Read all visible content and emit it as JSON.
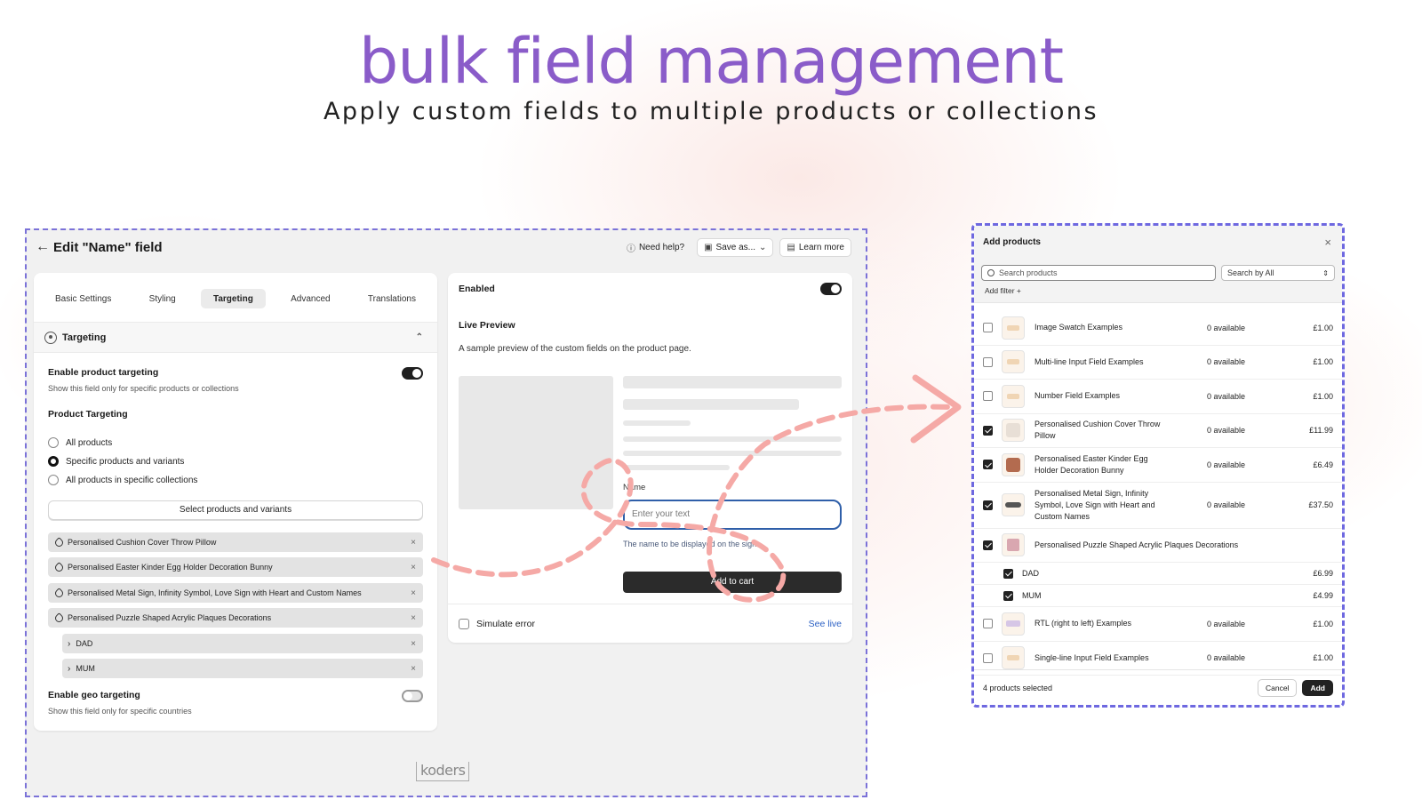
{
  "hero": {
    "title": "bulk field management",
    "subtitle": "Apply custom fields to multiple products or collections"
  },
  "editor": {
    "title": "Edit \"Name\" field",
    "actions": {
      "help": "Need help?",
      "save_as": "Save as...",
      "learn_more": "Learn more"
    },
    "tabs": [
      {
        "label": "Basic Settings",
        "active": false
      },
      {
        "label": "Styling",
        "active": false
      },
      {
        "label": "Targeting",
        "active": true
      },
      {
        "label": "Advanced",
        "active": false
      },
      {
        "label": "Translations",
        "active": false
      }
    ],
    "section_title": "Targeting",
    "product_targeting": {
      "label": "Enable product targeting",
      "help": "Show this field only for specific products or collections",
      "enabled": true
    },
    "product_targeting_heading": "Product Targeting",
    "radio_options": [
      {
        "label": "All products",
        "selected": false
      },
      {
        "label": "Specific products and variants",
        "selected": true
      },
      {
        "label": "All products in specific collections",
        "selected": false
      }
    ],
    "select_button": "Select products and variants",
    "chips": [
      "Personalised Cushion Cover Throw Pillow",
      "Personalised Easter Kinder Egg Holder Decoration Bunny",
      "Personalised Metal Sign, Infinity Symbol, Love Sign with Heart and Custom Names",
      "Personalised Puzzle Shaped Acrylic Plaques Decorations"
    ],
    "sub_chips": [
      "DAD",
      "MUM"
    ],
    "geo_targeting": {
      "label": "Enable geo targeting",
      "help": "Show this field only for specific countries",
      "enabled": false
    },
    "preview": {
      "enabled_label": "Enabled",
      "title": "Live Preview",
      "description": "A sample preview of the custom fields on the product page.",
      "field_label": "Name",
      "placeholder": "Enter your text",
      "help": "The name to be displayed on the sign",
      "add_to_cart": "Add to cart",
      "simulate_error": "Simulate error",
      "see_live": "See live"
    },
    "logo": "koders"
  },
  "modal": {
    "title": "Add products",
    "search_placeholder": "Search products",
    "search_by": "Search by All",
    "add_filter": "Add filter +",
    "products": [
      {
        "name": "Image Swatch Examples",
        "available": "0 available",
        "price": "£1.00",
        "checked": false
      },
      {
        "name": "Multi-line Input Field Examples",
        "available": "0 available",
        "price": "£1.00",
        "checked": false
      },
      {
        "name": "Number Field Examples",
        "available": "0 available",
        "price": "£1.00",
        "checked": false
      },
      {
        "name": "Personalised Cushion Cover Throw Pillow",
        "available": "0 available",
        "price": "£11.99",
        "checked": true
      },
      {
        "name": "Personalised Easter Kinder Egg Holder Decoration Bunny",
        "available": "0 available",
        "price": "£6.49",
        "checked": true
      },
      {
        "name": "Personalised Metal Sign, Infinity Symbol, Love Sign with Heart and Custom Names",
        "available": "0 available",
        "price": "£37.50",
        "checked": true
      },
      {
        "name": "Personalised Puzzle Shaped Acrylic Plaques Decorations",
        "checked": true
      },
      {
        "name": "RTL (right to left) Examples",
        "available": "0 available",
        "price": "£1.00",
        "checked": false
      },
      {
        "name": "Single-line Input Field Examples",
        "available": "0 available",
        "price": "£1.00",
        "checked": false
      }
    ],
    "variants": [
      {
        "name": "DAD",
        "price": "£6.99",
        "checked": true
      },
      {
        "name": "MUM",
        "price": "£4.99",
        "checked": true
      }
    ],
    "selected_count": "4 products selected",
    "cancel": "Cancel",
    "add": "Add"
  },
  "colors": {
    "title": "#8a5cc9",
    "frame_dash": "#7b72d8",
    "annotation": "#f5a9a6",
    "link": "#2c61c4"
  }
}
